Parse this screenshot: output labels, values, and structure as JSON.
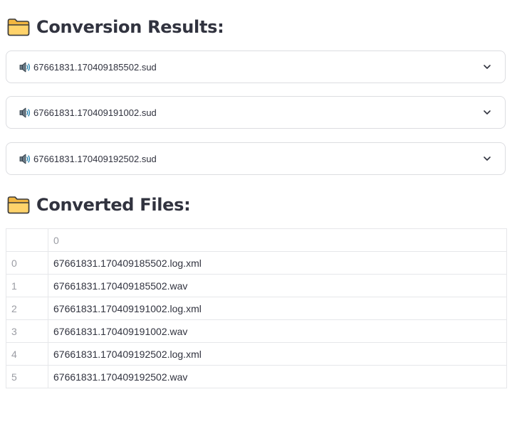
{
  "conversion_results": {
    "title": "Conversion Results:",
    "icon": "folder-icon",
    "expanders": [
      {
        "label": "67661831.170409185502.sud",
        "icon": "speaker-icon"
      },
      {
        "label": "67661831.170409191002.sud",
        "icon": "speaker-icon"
      },
      {
        "label": "67661831.170409192502.sud",
        "icon": "speaker-icon"
      }
    ]
  },
  "converted_files": {
    "title": "Converted Files:",
    "icon": "folder-icon",
    "table": {
      "header": [
        "",
        "0"
      ],
      "rows": [
        {
          "index": "0",
          "value": "67661831.170409185502.log.xml"
        },
        {
          "index": "1",
          "value": "67661831.170409185502.wav"
        },
        {
          "index": "2",
          "value": "67661831.170409191002.log.xml"
        },
        {
          "index": "3",
          "value": "67661831.170409191002.wav"
        },
        {
          "index": "4",
          "value": "67661831.170409192502.log.xml"
        },
        {
          "index": "5",
          "value": "67661831.170409192502.wav"
        }
      ]
    }
  },
  "colors": {
    "text": "#31333f",
    "muted": "#9a9ca3",
    "border": "#dcdde1",
    "folder_fill": "#f7c85a"
  }
}
